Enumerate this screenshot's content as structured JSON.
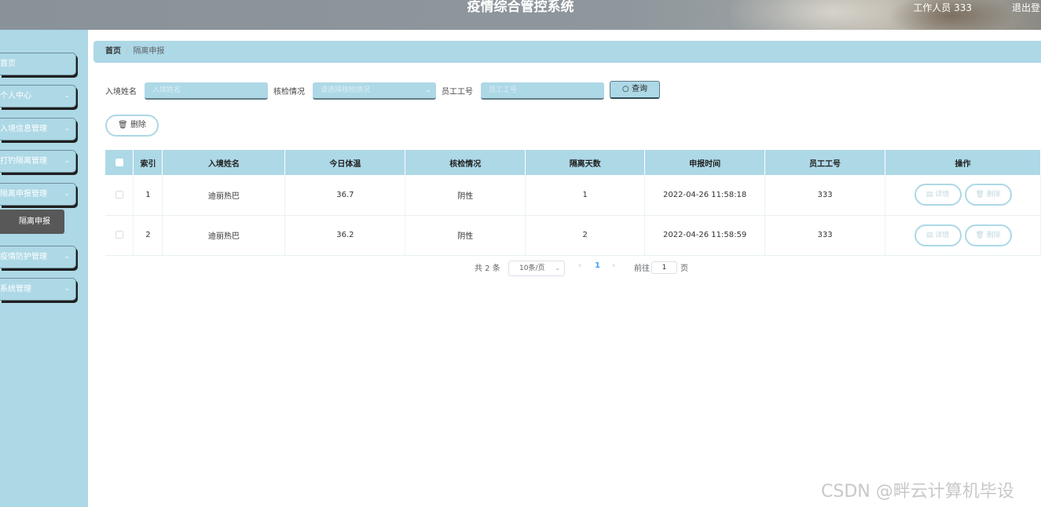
{
  "header": {
    "title": "疫情综合管控系统",
    "user": "工作人员 333",
    "logout": "退出登录"
  },
  "sidebar": {
    "items": [
      {
        "label": "首页",
        "has_chevron": false
      },
      {
        "label": "个人中心",
        "has_chevron": true
      },
      {
        "label": "入境信息管理",
        "has_chevron": true
      },
      {
        "label": "打钓隔离管理",
        "has_chevron": true
      },
      {
        "label": "隔离申报管理",
        "has_chevron": true
      },
      {
        "label": "疫情防护管理",
        "has_chevron": true
      },
      {
        "label": "系统管理",
        "has_chevron": true
      }
    ],
    "active_sub": "隔离申报"
  },
  "breadcrumb": {
    "home": "首页",
    "separator": "/",
    "current": "隔离申报"
  },
  "search": {
    "name_label": "入境姓名",
    "name_placeholder": "入境姓名",
    "check_label": "核检情况",
    "check_placeholder": "请选择核检情况",
    "staff_label": "员工工号",
    "staff_placeholder": "员工工号",
    "query_button": "查询"
  },
  "toolbar": {
    "delete_label": "删除"
  },
  "table": {
    "headers": [
      "索引",
      "入境姓名",
      "今日体温",
      "核检情况",
      "隔离天数",
      "申报时间",
      "员工工号",
      "操作"
    ],
    "rows": [
      {
        "index": "1",
        "name": "迪丽热巴",
        "temp": "36.7",
        "check": "阴性",
        "days": "1",
        "time": "2022-04-26 11:58:18",
        "staff": "333"
      },
      {
        "index": "2",
        "name": "迪丽热巴",
        "temp": "36.2",
        "check": "阴性",
        "days": "2",
        "time": "2022-04-26 11:58:59",
        "staff": "333"
      }
    ],
    "detail_label": "详情",
    "row_delete_label": "删除"
  },
  "pagination": {
    "total": "共 2 条",
    "page_size": "10条/页",
    "current_page": "1",
    "goto_label": "前往",
    "goto_value": "1",
    "page_suffix": "页"
  },
  "watermark": "CSDN @畔云计算机毕设",
  "colors": {
    "accent": "#add8e6",
    "sub_menu_active": "#585858"
  }
}
